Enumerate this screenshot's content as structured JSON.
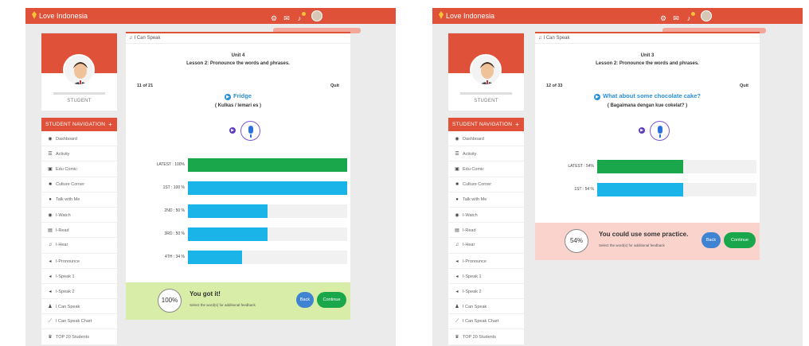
{
  "colors": {
    "primary": "#e0513a",
    "accent_blue": "#2b8fd6",
    "green": "#1aa64a",
    "cyan": "#1ab4e9",
    "success_bg": "#d8eda7",
    "warning_bg": "#fad3cd"
  },
  "screens": [
    {
      "brand": "Love Indonesia",
      "topbar_icons": [
        "settings-icon",
        "mail-icon",
        "bell-icon"
      ],
      "role": "STUDENT",
      "nav_header": "STUDENT NAVIGATION",
      "nav_items": [
        {
          "icon": "dashboard-icon",
          "glyph": "◉",
          "label": "Dashboard"
        },
        {
          "icon": "activity-icon",
          "glyph": "☰",
          "label": "Activity"
        },
        {
          "icon": "comic-icon",
          "glyph": "▣",
          "label": "Edu Comic"
        },
        {
          "icon": "video-icon",
          "glyph": "■",
          "label": "Culture Corner"
        },
        {
          "icon": "chat-icon",
          "glyph": "●",
          "label": "Talk with Me"
        },
        {
          "icon": "eye-icon",
          "glyph": "◉",
          "label": "I-Watch"
        },
        {
          "icon": "book-icon",
          "glyph": "▤",
          "label": "I-Read"
        },
        {
          "icon": "headphones-icon",
          "glyph": "♫",
          "label": "I-Hear"
        },
        {
          "icon": "speaker-icon",
          "glyph": "◂",
          "label": "I-Pronounce"
        },
        {
          "icon": "speaker-icon",
          "glyph": "◂",
          "label": "I-Speak 1"
        },
        {
          "icon": "volume-icon",
          "glyph": "◂",
          "label": "I-Speak 2"
        },
        {
          "icon": "person-icon",
          "glyph": "♟",
          "label": "I Can Speak"
        },
        {
          "icon": "line-chart-icon",
          "glyph": "⟋",
          "label": "I Can Speak Chart"
        },
        {
          "icon": "trophy-icon",
          "glyph": "♛",
          "label": "TOP 20 Students"
        }
      ],
      "breadcrumb": "I Can Speak",
      "unit": "Unit 4",
      "lesson": "Lesson 2: Pronounce the words and phrases.",
      "count": "11 of 21",
      "quit": "Quit",
      "word": "Fridge",
      "translation": "( Kulkas / lemari es )",
      "attempts": [
        {
          "label": "LATEST : 100%",
          "value": 100,
          "color": "#1aa64a"
        },
        {
          "label": "1ST : 100 %",
          "value": 100,
          "color": "#1ab4e9"
        },
        {
          "label": "2ND : 50 %",
          "value": 50,
          "color": "#1ab4e9"
        },
        {
          "label": "3RD : 50 %",
          "value": 50,
          "color": "#1ab4e9"
        },
        {
          "label": "4TH : 34 %",
          "value": 34,
          "color": "#1ab4e9"
        }
      ],
      "score": "100%",
      "feedback_title": "You got it!",
      "feedback_sub": "Select the word(s) for additional feedback",
      "back_label": "Back",
      "continue_label": "Continue"
    },
    {
      "brand": "Love Indonesia",
      "topbar_icons": [
        "settings-icon",
        "mail-icon",
        "bell-icon"
      ],
      "role": "STUDENT",
      "nav_header": "STUDENT NAVIGATION",
      "nav_items": [
        {
          "icon": "dashboard-icon",
          "glyph": "◉",
          "label": "Dashboard"
        },
        {
          "icon": "activity-icon",
          "glyph": "☰",
          "label": "Activity"
        },
        {
          "icon": "comic-icon",
          "glyph": "▣",
          "label": "Edu Comic"
        },
        {
          "icon": "video-icon",
          "glyph": "■",
          "label": "Culture Corner"
        },
        {
          "icon": "chat-icon",
          "glyph": "●",
          "label": "Talk with Me"
        },
        {
          "icon": "eye-icon",
          "glyph": "◉",
          "label": "I-Watch"
        },
        {
          "icon": "book-icon",
          "glyph": "▤",
          "label": "I-Read"
        },
        {
          "icon": "headphones-icon",
          "glyph": "♫",
          "label": "I-Hear"
        },
        {
          "icon": "speaker-icon",
          "glyph": "◂",
          "label": "I-Pronounce"
        },
        {
          "icon": "speaker-icon",
          "glyph": "◂",
          "label": "I-Speak 1"
        },
        {
          "icon": "volume-icon",
          "glyph": "◂",
          "label": "I-Speak 2"
        },
        {
          "icon": "person-icon",
          "glyph": "♟",
          "label": "I Can Speak"
        },
        {
          "icon": "line-chart-icon",
          "glyph": "⟋",
          "label": "I Can Speak Chart"
        },
        {
          "icon": "trophy-icon",
          "glyph": "♛",
          "label": "TOP 20 Students"
        }
      ],
      "breadcrumb": "I Can Speak",
      "unit": "Unit 3",
      "lesson": "Lesson 2: Pronounce the words and phrases.",
      "count": "12 of 33",
      "quit": "Quit",
      "word": "What about some chocolate cake?",
      "translation": "( Bagaimana dengan kue cokelat? )",
      "attempts": [
        {
          "label": "LATEST : 54%",
          "value": 54,
          "color": "#1aa64a"
        },
        {
          "label": "1ST : 54 %",
          "value": 54,
          "color": "#1ab4e9"
        }
      ],
      "score": "54%",
      "feedback_title": "You could use some practice.",
      "feedback_sub": "Select the word(s) for additional feedback",
      "back_label": "Back",
      "continue_label": "Continue"
    }
  ]
}
